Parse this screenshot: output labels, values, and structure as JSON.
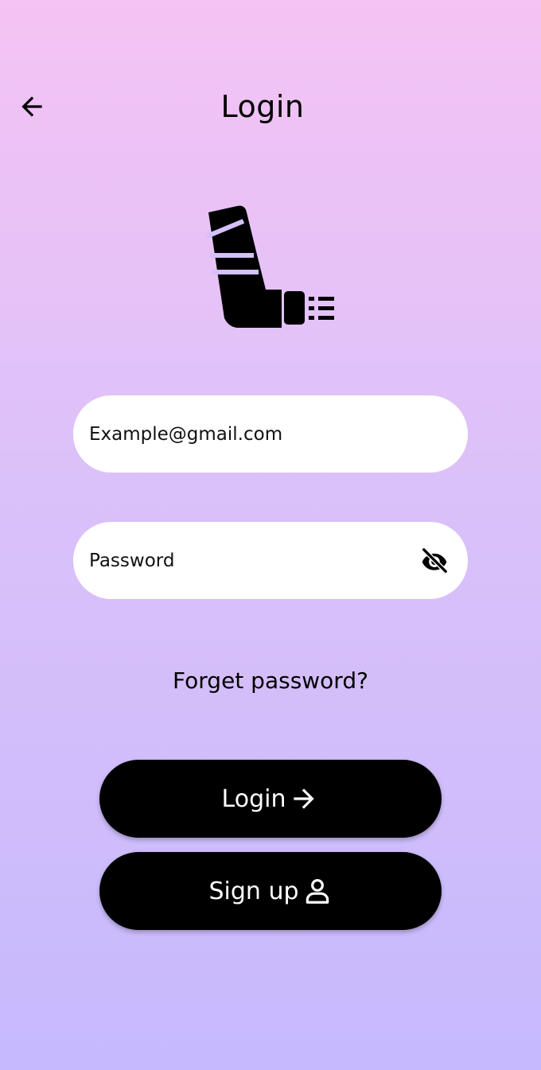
{
  "header": {
    "title": "Login",
    "back_icon": "arrow-back-icon"
  },
  "logo": {
    "icon": "inhaler-icon"
  },
  "form": {
    "email": {
      "placeholder": "Example@gmail.com",
      "value": ""
    },
    "password": {
      "placeholder": "Password",
      "value": "",
      "visibility_icon": "eye-off-icon"
    },
    "forgot_label": "Forget password?"
  },
  "actions": {
    "login_label": "Login",
    "login_icon": "arrow-forward-icon",
    "signup_label": "Sign up",
    "signup_icon": "person-icon"
  },
  "colors": {
    "gradient_top": "#f5c3f4",
    "gradient_bottom": "#c6b9fd",
    "button_bg": "#000000",
    "field_bg": "#ffffff"
  }
}
